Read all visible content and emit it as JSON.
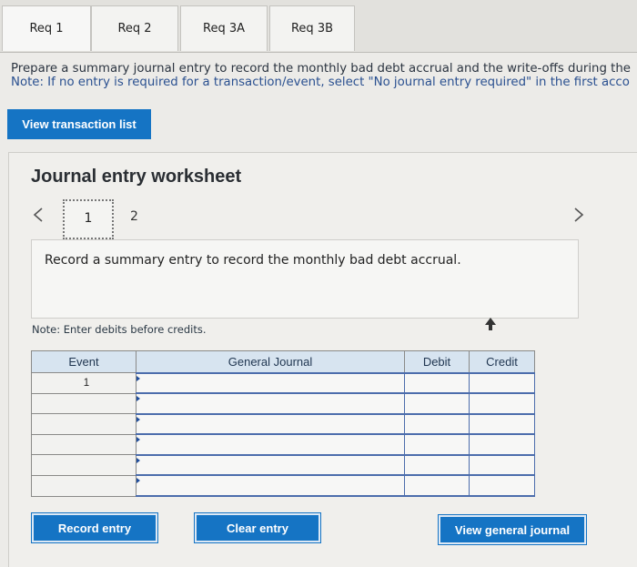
{
  "tabs": [
    {
      "label": "Req 1"
    },
    {
      "label": "Req 2"
    },
    {
      "label": "Req 3A"
    },
    {
      "label": "Req 3B"
    }
  ],
  "instructions": {
    "main": "Prepare a summary journal entry to record the monthly bad debt accrual and the write-offs during the",
    "note": "Note: If no entry is required for a transaction/event, select \"No journal entry required\" in the first acco"
  },
  "view_transaction_list": "View transaction list",
  "worksheet": {
    "title": "Journal entry worksheet",
    "prev_icon": "chevron-left-icon",
    "next_icon": "chevron-right-icon",
    "pages": [
      "1",
      "2"
    ],
    "description": "Record a summary entry to record the monthly bad debt accrual.",
    "note": "Note: Enter debits before credits."
  },
  "table": {
    "headers": {
      "event": "Event",
      "general_journal": "General Journal",
      "debit": "Debit",
      "credit": "Credit"
    },
    "rows": [
      {
        "event": "1",
        "account": "",
        "debit": "",
        "credit": ""
      },
      {
        "event": "",
        "account": "",
        "debit": "",
        "credit": ""
      },
      {
        "event": "",
        "account": "",
        "debit": "",
        "credit": ""
      },
      {
        "event": "",
        "account": "",
        "debit": "",
        "credit": ""
      },
      {
        "event": "",
        "account": "",
        "debit": "",
        "credit": ""
      },
      {
        "event": "",
        "account": "",
        "debit": "",
        "credit": ""
      }
    ]
  },
  "buttons": {
    "record_entry": "Record entry",
    "clear_entry": "Clear entry",
    "view_general_journal": "View general journal"
  },
  "colors": {
    "accent": "#1574c4",
    "header_bg": "#d7e4f0"
  }
}
